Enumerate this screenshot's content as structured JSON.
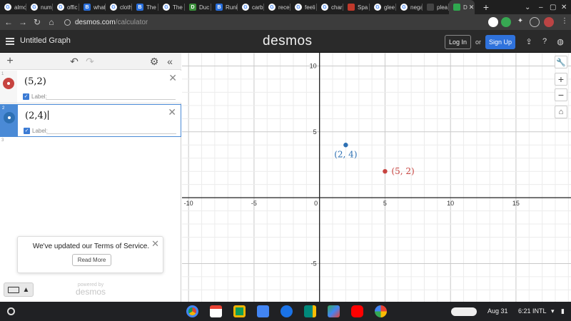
{
  "browser": {
    "tabs": [
      {
        "label": "almo",
        "icon": "google-icon"
      },
      {
        "label": "num",
        "icon": "google-icon"
      },
      {
        "label": "offic",
        "icon": "google-icon"
      },
      {
        "label": "what",
        "icon": "brainly-icon"
      },
      {
        "label": "cloth",
        "icon": "google-icon"
      },
      {
        "label": "The",
        "icon": "brainly-icon"
      },
      {
        "label": "The",
        "icon": "google-icon"
      },
      {
        "label": "Duc",
        "icon": "duolingo-icon"
      },
      {
        "label": "Runi",
        "icon": "brainly-icon"
      },
      {
        "label": "carb",
        "icon": "google-icon"
      },
      {
        "label": "rece",
        "icon": "google-icon"
      },
      {
        "label": "feeli",
        "icon": "google-icon"
      },
      {
        "label": "char",
        "icon": "google-icon"
      },
      {
        "label": "Spa",
        "icon": "spanish-flag-icon"
      },
      {
        "label": "glee",
        "icon": "google-icon"
      },
      {
        "label": "nega",
        "icon": "google-icon"
      },
      {
        "label": "plea",
        "icon": "page-icon"
      },
      {
        "label": "D",
        "icon": "desmos-icon",
        "active": true
      }
    ],
    "url_host": "desmos.com",
    "url_path": "/calculator"
  },
  "desmos": {
    "graph_title": "Untitled Graph",
    "logo": "desmos",
    "login_label": "Log In",
    "or_text": "or",
    "signup_label": "Sign Up"
  },
  "expressions": [
    {
      "index": "1",
      "latex": "(5,2)",
      "color": "#c74440",
      "label_text": "Label:",
      "label_checked": true,
      "selected": false
    },
    {
      "index": "2",
      "latex": "(2,4)",
      "color": "#2d70b3",
      "label_text": "Label:",
      "label_checked": true,
      "selected": true
    },
    {
      "index": "3"
    }
  ],
  "notice": {
    "message": "We've updated our Terms of Service.",
    "button": "Read More"
  },
  "footer": {
    "powered_by": "powered by",
    "powered_logo": "desmos"
  },
  "graph": {
    "x_range": [
      -10.5,
      19.2
    ],
    "y_range": [
      -7.9,
      11
    ],
    "x_ticks": [
      "-10",
      "-5",
      "0",
      "5",
      "10",
      "15"
    ],
    "y_ticks": [
      "10",
      "5",
      "-5"
    ],
    "points": [
      {
        "x": 2,
        "y": 4,
        "label": "(2, 4)",
        "color": "#2d70b3",
        "label_side": "below"
      },
      {
        "x": 5,
        "y": 2,
        "label": "(5, 2)",
        "color": "#c74440",
        "label_side": "right"
      }
    ]
  },
  "shelf": {
    "date": "Aug 31",
    "time": "6:21",
    "locale": "INTL",
    "apps": [
      "chrome-icon",
      "gmail-icon",
      "classroom-icon",
      "files-icon",
      "messages-icon",
      "meet-icon",
      "play-store-icon",
      "youtube-icon",
      "photos-icon"
    ]
  }
}
